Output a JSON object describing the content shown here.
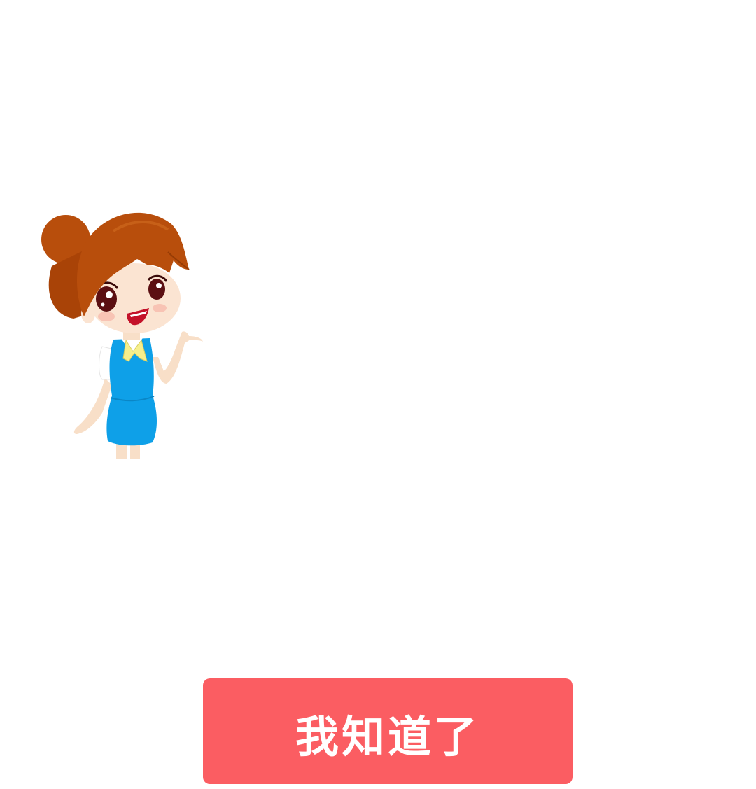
{
  "guide": {
    "illustration": "customer-service-girl-illustration"
  },
  "confirm_button": {
    "label": "我知道了"
  },
  "colors": {
    "background": "#ffffff",
    "button": "#fb5d62",
    "button_text": "#ffffff"
  }
}
